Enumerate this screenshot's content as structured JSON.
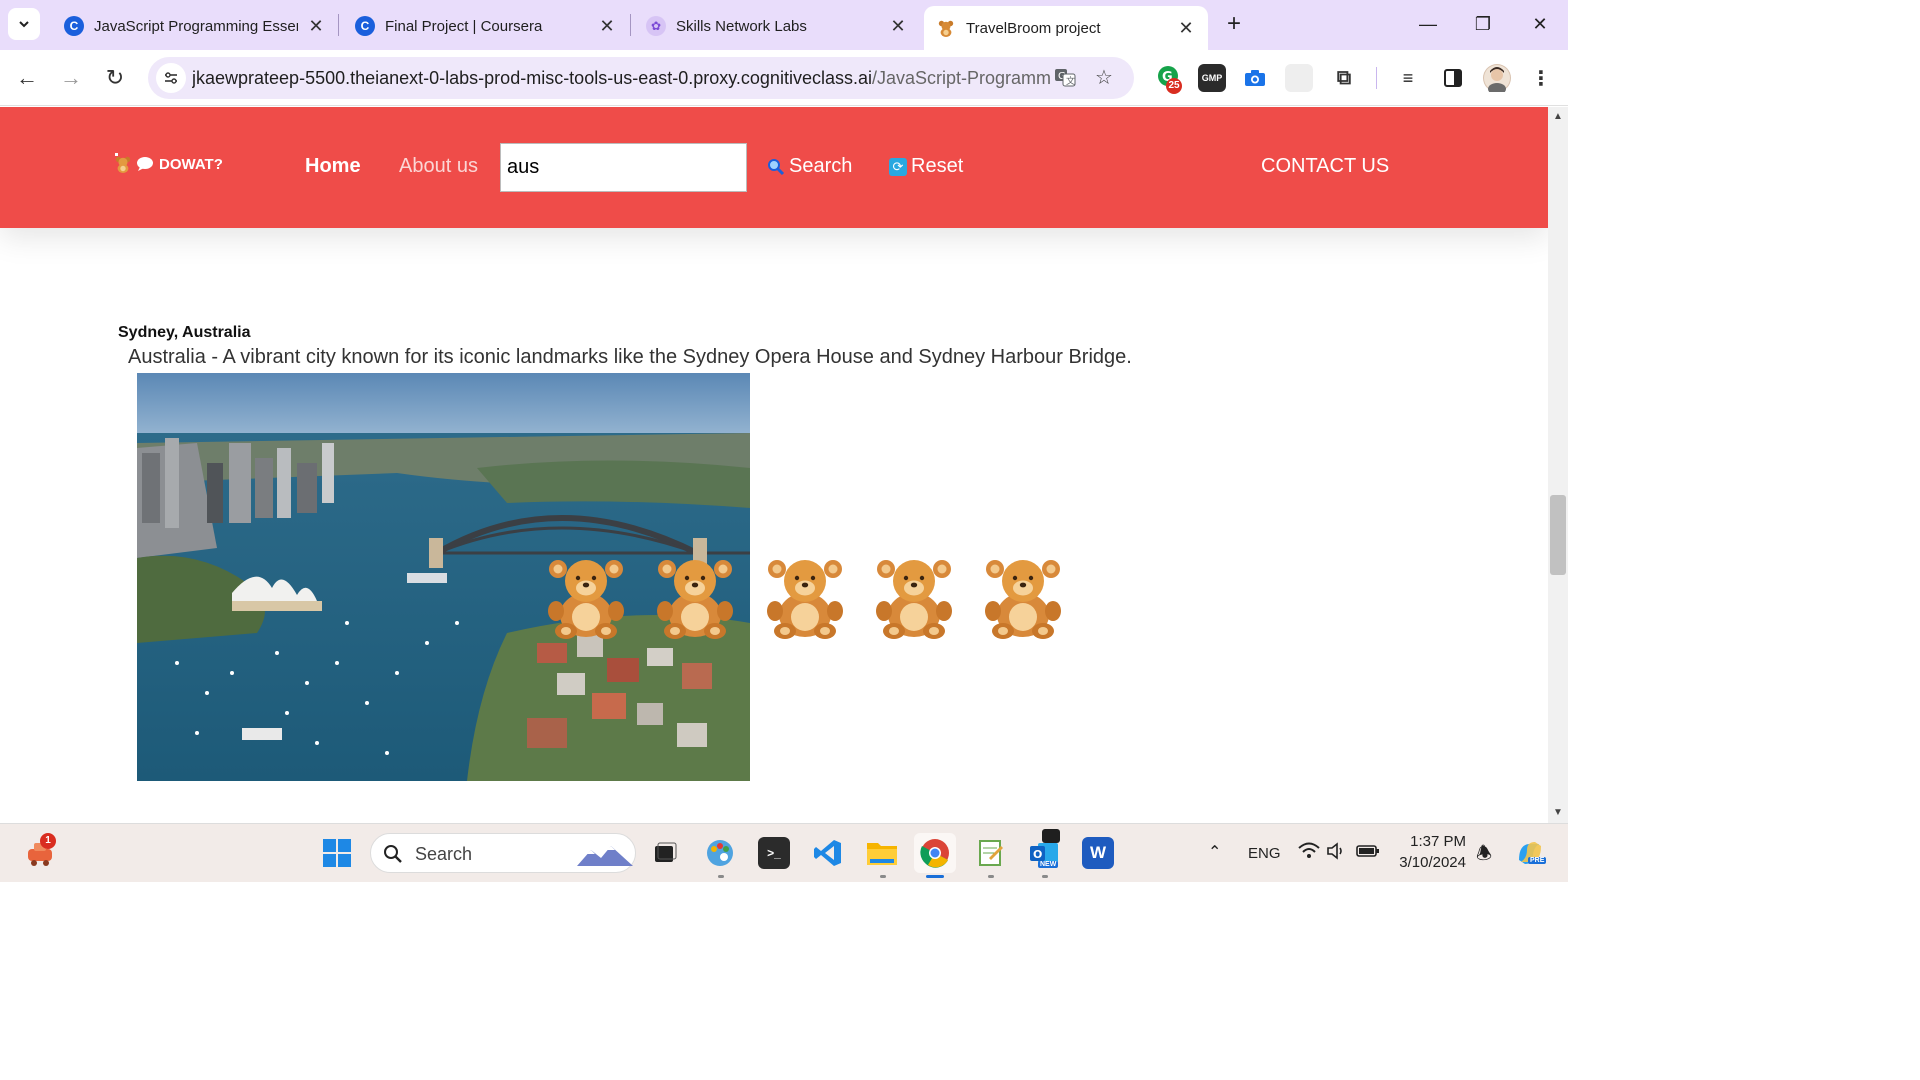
{
  "browser": {
    "tabs": [
      {
        "title": "JavaScript Programming Essent",
        "favicon": "coursera-c-icon"
      },
      {
        "title": "Final Project | Coursera",
        "favicon": "coursera-c-icon"
      },
      {
        "title": "Skills Network Labs",
        "favicon": "skills-network-icon"
      },
      {
        "title": "TravelBroom project",
        "favicon": "teddy-bear-icon",
        "active": true
      }
    ],
    "new_tab_label": "+",
    "url_main": "jkaewprateep-5500.theianext-0-labs-prod-misc-tools-us-east-0.proxy.cognitiveclass.ai",
    "url_rest": "/JavaScript-Programming...",
    "extensions": [
      {
        "name": "grammarly-icon",
        "badge": "25"
      },
      {
        "name": "gmp-icon",
        "label": "GMP"
      }
    ]
  },
  "site": {
    "logo_text": "DOWAT?",
    "nav": {
      "home": "Home",
      "about": "About us",
      "search_value": "aus",
      "search_button": "Search",
      "reset_button": "Reset",
      "contact": "CONTACT US"
    },
    "result": {
      "title": "Sydney, Australia",
      "description": "Australia - A vibrant city known for its iconic landmarks like the Sydney Opera House and Sydney Harbour Bridge."
    }
  },
  "taskbar": {
    "search_label": "Search",
    "notification_count": "1",
    "language": "ENG",
    "time": "1:37 PM",
    "date": "3/10/2024",
    "copilot_badge": "PRE",
    "outlook_badge": "NEW"
  }
}
